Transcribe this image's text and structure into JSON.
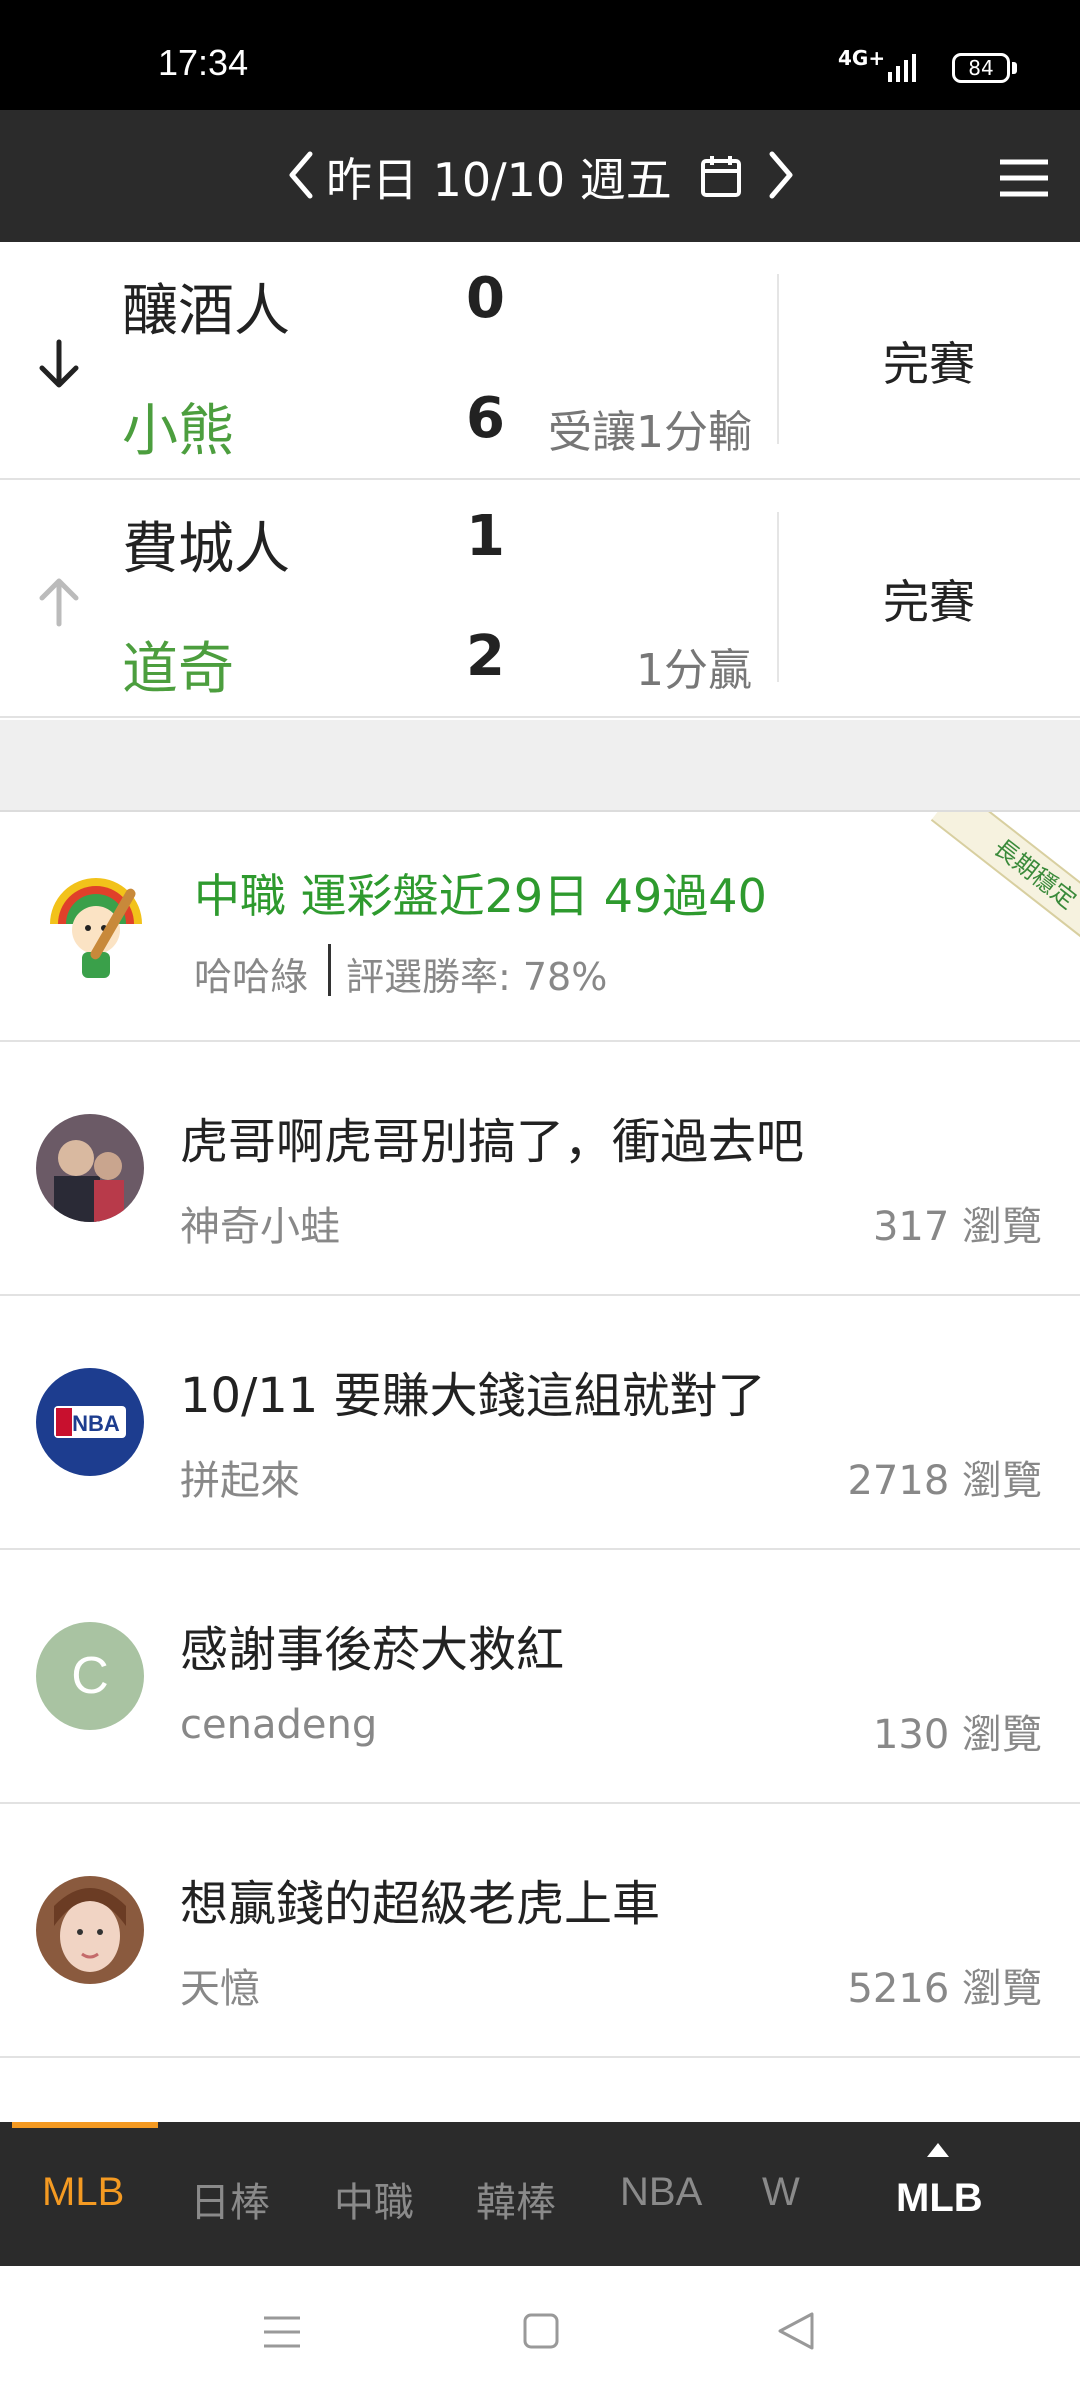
{
  "status_bar": {
    "time": "17:34",
    "network": "4G+",
    "battery": "84"
  },
  "header": {
    "title": "昨日 10/10 週五"
  },
  "games": [
    {
      "away_team": "釀酒人",
      "away_score": "0",
      "home_team": "小熊",
      "home_score": "6",
      "spread": "受讓1分輸",
      "status": "完賽"
    },
    {
      "away_team": "費城人",
      "away_score": "1",
      "home_team": "道奇",
      "home_score": "2",
      "spread": "1分贏",
      "status": "完賽"
    }
  ],
  "promo": {
    "title": "中職 運彩盤近29日 49過40",
    "author": "哈哈綠",
    "win_rate": "評選勝率: 78%",
    "badge": "長期穩定"
  },
  "posts": [
    {
      "title": "虎哥啊虎哥別搞了，衝過去吧",
      "author": "神奇小蛙",
      "views": "317 瀏覽"
    },
    {
      "title": "10/11 要賺大錢這組就對了",
      "author": "拼起來",
      "views": "2718 瀏覽",
      "avatar_text": "NBA"
    },
    {
      "title": "感謝事後菸大救紅",
      "author": "cenadeng",
      "views": "130 瀏覽",
      "avatar_text": "C"
    },
    {
      "title": "想贏錢的超級老虎上車",
      "author": "天憶",
      "views": "5216 瀏覽"
    }
  ],
  "tabs": {
    "items": [
      "MLB",
      "日棒",
      "中職",
      "韓棒",
      "NBA",
      "W"
    ],
    "current": "MLB"
  },
  "colors": {
    "accent": "#f49a22",
    "green": "#4c9e3e",
    "nav_bg": "#2b2b2b"
  }
}
